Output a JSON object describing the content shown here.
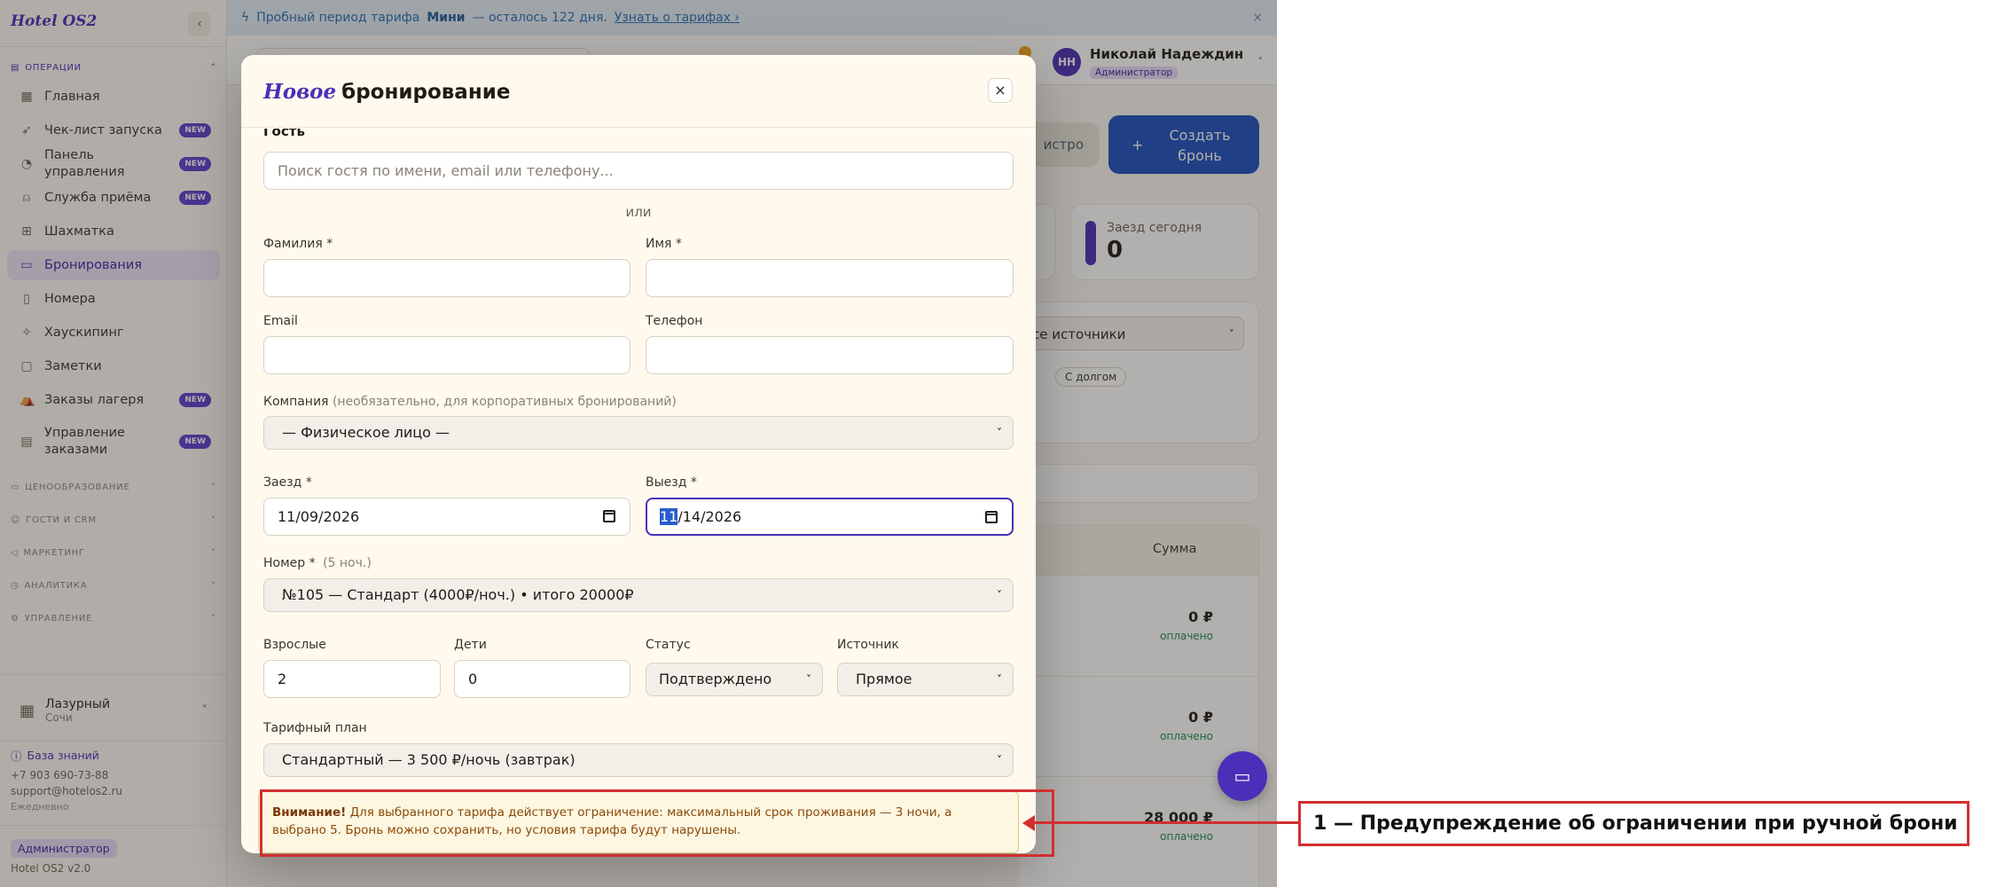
{
  "app": {
    "logo": "Hotel OS2",
    "collapse_icon": "chevron-left-icon"
  },
  "trial_banner": {
    "text_prefix": "Пробный период тарифа",
    "plan": "Мини",
    "text_suffix": "— осталось 122 дня.",
    "link": "Узнать о тарифах ›",
    "close": "×"
  },
  "sidebar": {
    "sections": [
      {
        "label": "Операции",
        "expanded": true
      },
      {
        "label": "Ценообразование",
        "expanded": false
      },
      {
        "label": "Гости и CRM",
        "expanded": false
      },
      {
        "label": "Маркетинг",
        "expanded": false
      },
      {
        "label": "Аналитика",
        "expanded": false
      },
      {
        "label": "Управление",
        "expanded": false
      }
    ],
    "items": [
      {
        "label": "Главная",
        "icon": "dashboard-icon",
        "badge": ""
      },
      {
        "label": "Чек-лист запуска",
        "icon": "rocket-icon",
        "badge": "NEW"
      },
      {
        "label": "Панель управления",
        "icon": "gauge-icon",
        "badge": "NEW"
      },
      {
        "label": "Служба приёма",
        "icon": "bell-icon",
        "badge": "NEW"
      },
      {
        "label": "Шахматка",
        "icon": "grid-icon",
        "badge": ""
      },
      {
        "label": "Бронирования",
        "icon": "clipboard-icon",
        "badge": "",
        "active": true
      },
      {
        "label": "Номера",
        "icon": "door-icon",
        "badge": ""
      },
      {
        "label": "Хаускипинг",
        "icon": "sparkle-icon",
        "badge": ""
      },
      {
        "label": "Заметки",
        "icon": "note-icon",
        "badge": ""
      },
      {
        "label": "Заказы лагеря",
        "icon": "tent-icon",
        "badge": "NEW"
      },
      {
        "label": "Управление заказами",
        "icon": "receipt-icon",
        "badge": "NEW"
      }
    ],
    "hotel": {
      "name": "Лазурный",
      "city": "Сочи"
    },
    "knowledge_base": "База знаний",
    "phone": "+7 903 690-73-88",
    "email": "support@hotelos2.ru",
    "schedule": "Ежедневно",
    "role": "Администратор",
    "version": "Hotel OS2 v2.0"
  },
  "header": {
    "user": {
      "initials": "НН",
      "name": "Николай Надеждин",
      "role": "Администратор"
    }
  },
  "page": {
    "quick_button": "истро",
    "create_button": "Создать бронь",
    "stat": {
      "label": "Заезд сегодня",
      "value": "0"
    },
    "source_filter": "се источники",
    "chip_debt": "С долгом",
    "table": {
      "sum_header": "Сумма",
      "rows": [
        {
          "amount": "0 ₽",
          "status": "оплачено"
        },
        {
          "amount": "0 ₽",
          "status": "оплачено"
        },
        {
          "amount": "28 000 ₽",
          "status": "оплачено"
        }
      ]
    }
  },
  "modal": {
    "title_accent": "Новое",
    "title_rest": "бронирование",
    "close": "×",
    "guest_section": "Гость",
    "guest_search_placeholder": "Поиск гостя по имени, email или телефону...",
    "or": "или",
    "last_name_label": "Фамилия *",
    "first_name_label": "Имя *",
    "email_label": "Email",
    "phone_label": "Телефон",
    "company_label": "Компания",
    "company_hint": "(необязательно, для корпоративных бронирований)",
    "company_value": "— Физическое лицо —",
    "checkin_label": "Заезд *",
    "checkin_value": "11/09/2026",
    "checkout_label": "Выезд *",
    "checkout_month": "11",
    "checkout_rest": "/14/2026",
    "room_label": "Номер *",
    "room_nights": "(5 ноч.)",
    "room_value": "№105 — Стандарт (4000₽/ноч.) • итого 20000₽",
    "adults_label": "Взрослые",
    "adults_value": "2",
    "children_label": "Дети",
    "children_value": "0",
    "status_label": "Статус",
    "status_value": "Подтверждено",
    "source_label": "Источник",
    "source_value": "Прямое",
    "rate_label": "Тарифный план",
    "rate_value": "Стандартный — 3 500 ₽/ночь (завтрак)",
    "warning_strong": "Внимание!",
    "warning_text": "Для выбранного тарифа действует ограничение: максимальный срок проживания — 3 ночи, а выбрано 5. Бронь можно сохранить, но условия тарифа будут нарушены."
  },
  "annotation": {
    "label": "1 — Предупреждение об ограничении при ручной брони",
    "color": "#d32f2f"
  }
}
